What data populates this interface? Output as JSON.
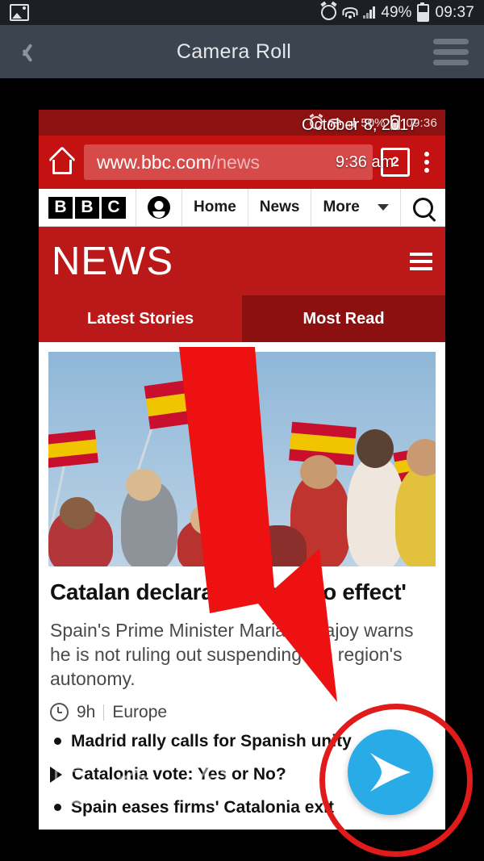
{
  "device_status_bar": {
    "left_icon": "gallery-image-icon",
    "icons": [
      "alarm-icon",
      "wifi-icon",
      "signal-icon",
      "battery-icon"
    ],
    "battery_percent": "49%",
    "time": "09:37"
  },
  "app_bar": {
    "back_icon": "back-chevron-icon",
    "title": "Camera Roll",
    "menu_icon": "hamburger-menu-icon"
  },
  "screenshot": {
    "overlay": {
      "date": "October 8, 2017",
      "time": "9:36 am"
    },
    "status_bar": {
      "icons": [
        "alarm-icon",
        "wifi-icon",
        "signal-icon",
        "battery-icon"
      ],
      "battery_percent": "50%",
      "time": "09:36"
    },
    "browser": {
      "home_icon": "home-icon",
      "url_main": "www.bbc.com",
      "url_path": "/news",
      "tab_count": "2",
      "overflow_icon": "vertical-dots-icon"
    },
    "bbc_nav": {
      "logo": [
        "B",
        "B",
        "C"
      ],
      "account_icon": "account-icon",
      "items": [
        "Home",
        "News",
        "More"
      ],
      "dropdown_icon": "chevron-down-icon",
      "search_icon": "search-icon"
    },
    "masthead": {
      "title": "NEWS",
      "menu_icon": "hamburger-menu-icon"
    },
    "tabs": [
      {
        "label": "Latest Stories",
        "active": true
      },
      {
        "label": "Most Read",
        "active": false
      }
    ],
    "article": {
      "image_alt": "crowd-waving-spanish-flags-photo",
      "headline": "Catalan declaration 'has no effect'",
      "summary": "Spain's Prime Minister Mariano Rajoy warns he is not ruling out suspending the region's autonomy.",
      "time_icon": "clock-icon",
      "time_ago": "9h",
      "section": "Europe"
    },
    "related_links": [
      {
        "icon": "bullet",
        "text": "Madrid rally calls for Spanish unity"
      },
      {
        "icon": "play",
        "text": "Catalonia vote: Yes or No?"
      },
      {
        "icon": "bullet",
        "text": "Spain eases firms' Catalonia exit"
      }
    ],
    "ghost_icons": [
      "trash-icon",
      "share-icon",
      "paperclip-icon"
    ]
  },
  "annotation": {
    "arrow_icon": "red-arrow-annotation",
    "circle_icon": "red-circle-highlight",
    "arrow_color": "#ee1111",
    "circle_color": "#e01b1b"
  },
  "fab": {
    "icon": "send-arrow-icon",
    "color": "#29abe8"
  }
}
